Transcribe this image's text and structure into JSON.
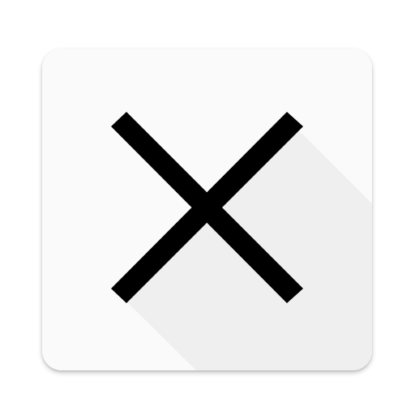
{
  "icon": {
    "name": "close-x-icon",
    "background_color": "#fafafa",
    "long_shadow_color": "#efefef",
    "glyph_color": "#000000"
  }
}
